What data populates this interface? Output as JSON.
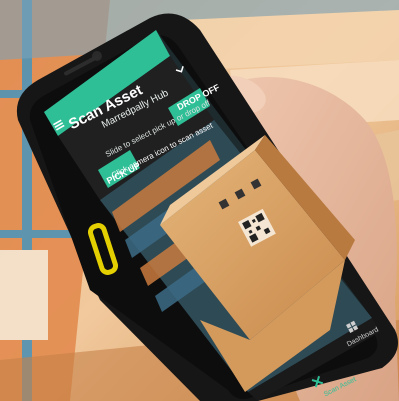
{
  "app": {
    "title": "Scan Asset",
    "hub_name": "Marredpally Hub",
    "instruction": "Slide to select pick up or drop off",
    "hint": "Click camera icon to scan asset",
    "pickup_label": "PICK UP",
    "dropoff_label": "DROP OFF"
  },
  "bottom_nav": {
    "items": [
      {
        "label": "Scan Asset",
        "icon": "scan-icon"
      },
      {
        "label": "Dashboard",
        "icon": "dashboard-icon"
      }
    ]
  },
  "colors": {
    "accent": "#2fbf96",
    "phone_body": "#161616",
    "side_button": "#e4d000"
  }
}
